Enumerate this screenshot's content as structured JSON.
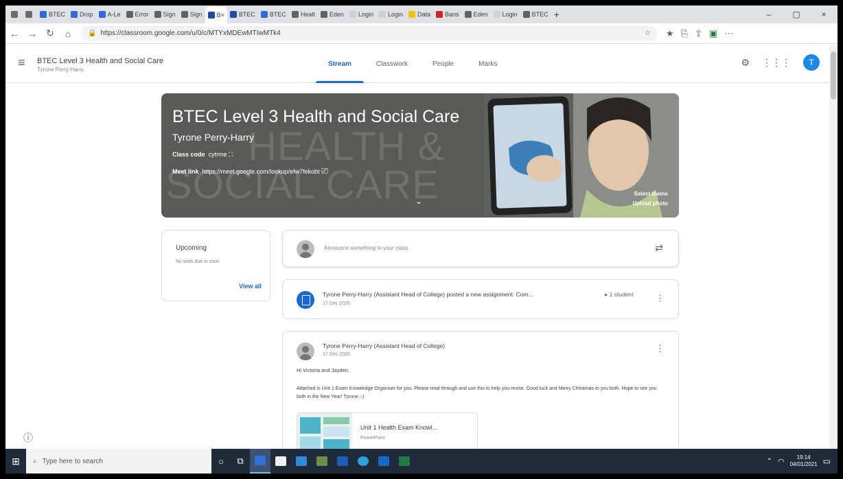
{
  "browser": {
    "tabs": [
      {
        "label": "",
        "color": "#6b6b6b"
      },
      {
        "label": "",
        "color": "#6b6b6b"
      },
      {
        "label": "BTEC",
        "color": "#3367d6"
      },
      {
        "label": "Drop",
        "color": "#3367d6"
      },
      {
        "label": "A-Le",
        "color": "#3367d6"
      },
      {
        "label": "Error",
        "color": "#5f6368"
      },
      {
        "label": "Sign",
        "color": "#5f6368"
      },
      {
        "label": "Sign",
        "color": "#5f6368"
      },
      {
        "label": "B",
        "color": "#1f4aa8",
        "active": true
      },
      {
        "label": "BTEC",
        "color": "#1f4aa8"
      },
      {
        "label": "BTEC",
        "color": "#3367d6"
      },
      {
        "label": "Healt",
        "color": "#5f6368"
      },
      {
        "label": "Eden",
        "color": "#5f6368"
      },
      {
        "label": "Login",
        "color": "#d0d0d0"
      },
      {
        "label": "Login",
        "color": "#d0d0d0"
      },
      {
        "label": "Data",
        "color": "#f4c20d"
      },
      {
        "label": "Bans",
        "color": "#c62828"
      },
      {
        "label": "Eden",
        "color": "#5f6368"
      },
      {
        "label": "Login",
        "color": "#d0d0d0"
      },
      {
        "label": "BTEC",
        "color": "#5f6368"
      }
    ],
    "new_tab": "+",
    "url": "https://classroom.google.com/u/0/c/MTYxMDEwMTIwMTk4",
    "win": {
      "min": "–",
      "max": "▢",
      "close": "×"
    }
  },
  "classroom": {
    "course_title": "BTEC Level 3 Health and Social Care",
    "course_subtitle": "Tyrone Perry-Harry",
    "tabs": [
      "Stream",
      "Classwork",
      "People",
      "Marks"
    ],
    "avatar_letter": "T"
  },
  "banner": {
    "title": "BTEC Level 3 Health and Social Care",
    "teacher": "Tyrone Perry-Harry",
    "class_code_label": "Class code",
    "class_code_value": "cytrme",
    "meet_label": "Meet link",
    "meet_value": "https://meet.google.com/lookup/efw7fekobt",
    "bg_text_1": "HEALTH &",
    "bg_text_2": "SOCIAL CARE",
    "select_theme": "Select theme",
    "upload_photo": "Upload photo"
  },
  "upcoming": {
    "title": "Upcoming",
    "empty": "No work due in soon",
    "view_all": "View all"
  },
  "announce": {
    "placeholder": "Announce something to your class"
  },
  "assignment": {
    "text": "Tyrone Perry-Harry (Assistant Head of College) posted a new assignment: Com...",
    "count": "1 student",
    "date": "17 Dec 2020"
  },
  "post": {
    "author": "Tyrone Perry-Harry (Assistant Head of College)",
    "date": "17 Dec 2020",
    "greeting": "Hi Victoria and Jayden,",
    "body": "Attached is Unit 1 Exam Knowledge Organiser for you. Please read through and use this to help you revise. Good luck and Merry Christmas to you both. Hope to see you both in the New Year! Tyrone :-)",
    "attachment_name": "Unit 1 Health Exam Knowl...",
    "attachment_type": "PowerPoint"
  },
  "taskbar": {
    "search_placeholder": "Type here to search",
    "time": "19:14",
    "date": "04/01/2021"
  }
}
